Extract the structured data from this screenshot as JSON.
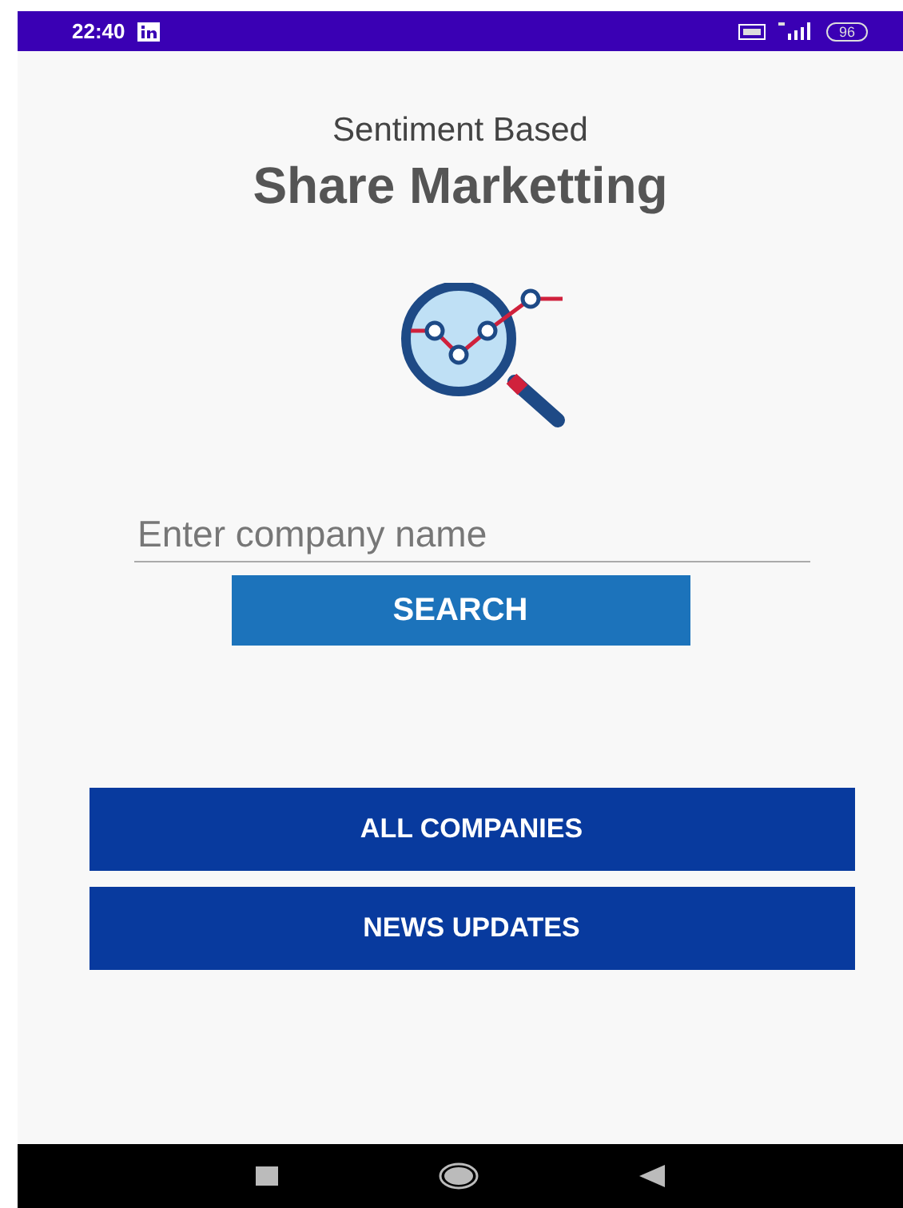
{
  "status_bar": {
    "time": "22:40",
    "battery": "96"
  },
  "header": {
    "subtitle": "Sentiment Based",
    "title": "Share Marketting"
  },
  "search": {
    "placeholder": "Enter company name",
    "button": "SEARCH"
  },
  "buttons": [
    "ALL COMPANIES",
    "NEWS UPDATES"
  ]
}
